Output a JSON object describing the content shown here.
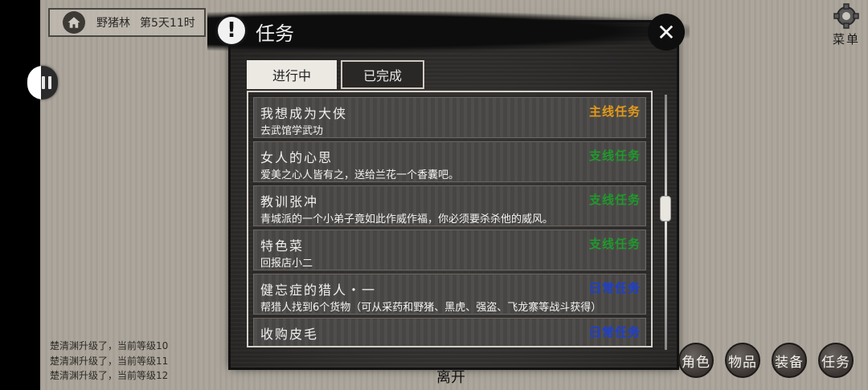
{
  "location": {
    "place": "野猪林",
    "time": "第5天11时"
  },
  "menu": {
    "label": "菜单",
    "icon": "gear-icon"
  },
  "dialog": {
    "title": "任务",
    "tabs": [
      "进行中",
      "已完成"
    ],
    "active_tab": "进行中",
    "quests": [
      {
        "name": "我想成为大侠",
        "type": "主线任务",
        "type_color": "#e49a1a",
        "desc": "去武馆学武功"
      },
      {
        "name": "女人的心思",
        "type": "支线任务",
        "type_color": "#1f9a2c",
        "desc": "爱美之心人皆有之，送给兰花一个香囊吧。"
      },
      {
        "name": "教训张冲",
        "type": "支线任务",
        "type_color": "#1f9a2c",
        "desc": "青城派的一个小弟子竟如此作威作福，你必须要杀杀他的威风。"
      },
      {
        "name": "特色菜",
        "type": "支线任务",
        "type_color": "#1f9a2c",
        "desc": "回报店小二"
      },
      {
        "name": "健忘症的猎人・一",
        "type": "日常任务",
        "type_color": "#1a3fd6",
        "desc": "帮猎人找到6个货物（可从采药和野猪、黑虎、强盗、飞龙寨等战斗获得）"
      },
      {
        "name": "收购皮毛",
        "type": "日常任务",
        "type_color": "#1a3fd6",
        "desc": ""
      }
    ]
  },
  "leave_label": "离开",
  "log": [
    "楚清渊升级了，当前等级10",
    "楚清渊升级了，当前等级11",
    "楚清渊升级了，当前等级12"
  ],
  "bottom_buttons": [
    "角色",
    "物品",
    "装备",
    "任务"
  ]
}
